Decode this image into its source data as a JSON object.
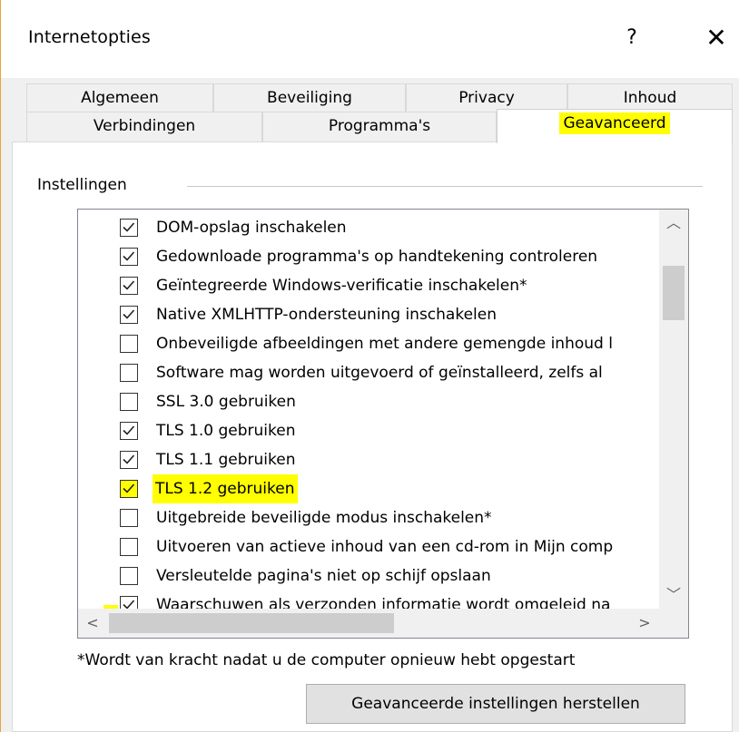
{
  "window": {
    "title": "Internetopties",
    "help": "?",
    "close": "✕"
  },
  "tabs_row_back": [
    "Algemeen",
    "Beveiliging",
    "Privacy",
    "Inhoud"
  ],
  "tabs_row_front": [
    "Verbindingen",
    "Programma's",
    "Geavanceerd"
  ],
  "active_tab": "Geavanceerd",
  "group_label": "Instellingen",
  "settings": [
    {
      "label": "DOM-opslag inschakelen",
      "checked": true
    },
    {
      "label": "Gedownloade programma's op handtekening controleren",
      "checked": true
    },
    {
      "label": "Geïntegreerde Windows-verificatie inschakelen*",
      "checked": true
    },
    {
      "label": "Native XMLHTTP-ondersteuning inschakelen",
      "checked": true
    },
    {
      "label": "Onbeveiligde afbeeldingen met andere gemengde inhoud l",
      "checked": false
    },
    {
      "label": "Software mag worden uitgevoerd of geïnstalleerd, zelfs al",
      "checked": false
    },
    {
      "label": "SSL 3.0 gebruiken",
      "checked": false
    },
    {
      "label": "TLS 1.0 gebruiken",
      "checked": true
    },
    {
      "label": "TLS 1.1 gebruiken",
      "checked": true
    },
    {
      "label": "TLS 1.2 gebruiken",
      "checked": true,
      "highlighted": true
    },
    {
      "label": "Uitgebreide beveiligde modus inschakelen*",
      "checked": false
    },
    {
      "label": "Uitvoeren van actieve inhoud van een cd-rom in Mijn comp",
      "checked": false
    },
    {
      "label": "Versleutelde pagina's niet op schijf opslaan",
      "checked": false
    },
    {
      "label": "Waarschuwen als verzonden informatie wordt omgeleid na",
      "checked": true
    }
  ],
  "footnote": "*Wordt van kracht nadat u de computer opnieuw hebt opgestart",
  "reset_button": "Geavanceerde instellingen herstellen",
  "colors": {
    "highlight": "#ffff00",
    "dialog_bg": "#f0f0f0",
    "panel_bg": "#ffffff"
  }
}
